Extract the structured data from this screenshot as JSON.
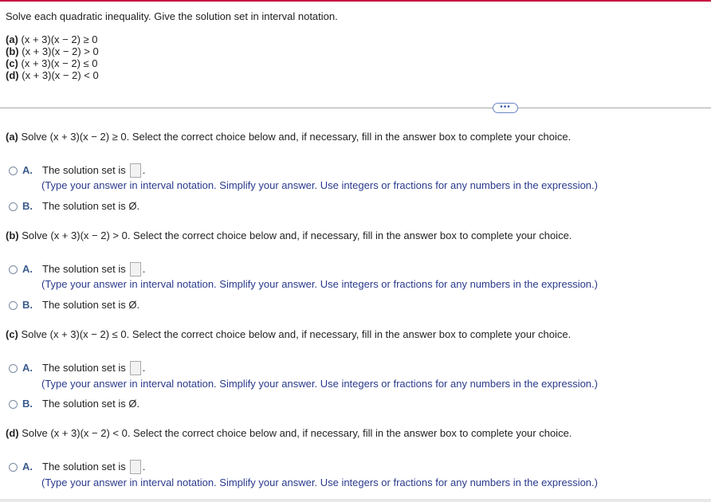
{
  "instructions": "Solve each quadratic inequality. Give the solution set in interval notation.",
  "problems": [
    {
      "label": "(a)",
      "expr": "(x + 3)(x − 2) ≥ 0"
    },
    {
      "label": "(b)",
      "expr": "(x + 3)(x − 2) > 0"
    },
    {
      "label": "(c)",
      "expr": "(x + 3)(x − 2) ≤ 0"
    },
    {
      "label": "(d)",
      "expr": "(x + 3)(x − 2) < 0"
    }
  ],
  "more_button": "•••",
  "parts": [
    {
      "label": "(a)",
      "prompt": "Solve (x + 3)(x − 2) ≥ 0. Select the correct choice below and, if necessary, fill in the answer box to complete your choice.",
      "choice_a_letter": "A.",
      "choice_a_text": "The solution set is",
      "choice_a_end": ".",
      "hint": "(Type your answer in interval notation. Simplify your answer. Use integers or fractions for any numbers in the expression.)",
      "choice_b_letter": "B.",
      "choice_b_text": "The solution set is Ø."
    },
    {
      "label": "(b)",
      "prompt": "Solve (x + 3)(x − 2) > 0. Select the correct choice below and, if necessary, fill in the answer box to complete your choice.",
      "choice_a_letter": "A.",
      "choice_a_text": "The solution set is",
      "choice_a_end": ".",
      "hint": "(Type your answer in interval notation. Simplify your answer. Use integers or fractions for any numbers in the expression.)",
      "choice_b_letter": "B.",
      "choice_b_text": "The solution set is Ø."
    },
    {
      "label": "(c)",
      "prompt": "Solve (x + 3)(x − 2) ≤ 0. Select the correct choice below and, if necessary, fill in the answer box to complete your choice.",
      "choice_a_letter": "A.",
      "choice_a_text": "The solution set is",
      "choice_a_end": ".",
      "hint": "(Type your answer in interval notation. Simplify your answer. Use integers or fractions for any numbers in the expression.)",
      "choice_b_letter": "B.",
      "choice_b_text": "The solution set is Ø."
    },
    {
      "label": "(d)",
      "prompt": "Solve (x + 3)(x − 2) < 0. Select the correct choice below and, if necessary, fill in the answer box to complete your choice.",
      "choice_a_letter": "A.",
      "choice_a_text": "The solution set is",
      "choice_a_end": ".",
      "hint": "(Type your answer in interval notation. Simplify your answer. Use integers or fractions for any numbers in the expression.)"
    }
  ],
  "colors": {
    "accent_bar": "#c8103e",
    "hint_text": "#2a3a8c",
    "choice_letter": "#3a5b8c"
  }
}
